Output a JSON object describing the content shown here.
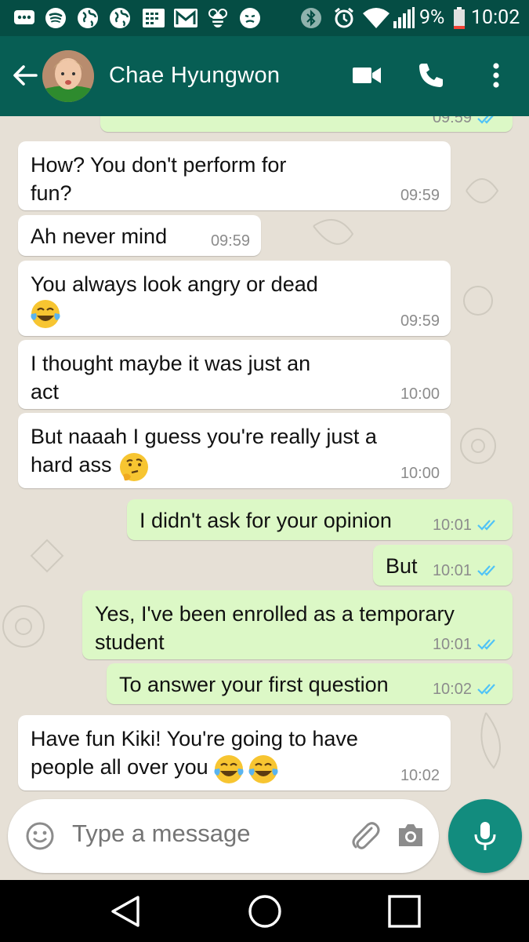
{
  "status_bar": {
    "battery": "9%",
    "time": "10:02"
  },
  "header": {
    "contact_name": "Chae Hyungwon"
  },
  "messages": [
    {
      "dir": "in",
      "lines": [
        "How? You don't perform for",
        "fun?"
      ],
      "time": "09:59"
    },
    {
      "dir": "in",
      "lines": [
        "Ah never mind"
      ],
      "time": "09:59"
    },
    {
      "dir": "in",
      "lines": [
        "You always look angry or dead",
        ""
      ],
      "emoji": "laughing-crying",
      "time": "09:59"
    },
    {
      "dir": "in",
      "lines": [
        "I thought maybe it was just an",
        "act"
      ],
      "time": "10:00"
    },
    {
      "dir": "in",
      "lines": [
        "But naaah I guess you're really just a",
        "hard ass"
      ],
      "emoji": "thinking",
      "time": "10:00"
    },
    {
      "dir": "out",
      "lines": [
        "I didn't ask for your opinion"
      ],
      "time": "10:01",
      "read": true
    },
    {
      "dir": "out",
      "lines": [
        "But"
      ],
      "time": "10:01",
      "read": true
    },
    {
      "dir": "out",
      "lines": [
        "Yes, I've been enrolled as a temporary",
        "student"
      ],
      "time": "10:01",
      "read": true
    },
    {
      "dir": "out",
      "lines": [
        "To answer your first question"
      ],
      "time": "10:02",
      "read": true
    },
    {
      "dir": "in",
      "lines": [
        "Have fun Kiki! You're going to have",
        "people all over you"
      ],
      "emoji": "laughing-crying x2",
      "time": "10:02"
    }
  ],
  "top_partial_message": {
    "time": "09:59"
  },
  "input": {
    "placeholder": "Type a message"
  },
  "colors": {
    "status_bar": "#054d44",
    "header": "#075e54",
    "outgoing_bubble": "#dcf8c6",
    "incoming_bubble": "#ffffff",
    "read_ticks": "#4fc3f7",
    "mic_button": "#128c7e"
  },
  "icons": [
    "back-arrow-icon",
    "video-call-icon",
    "phone-icon",
    "more-options-icon",
    "emoji-icon",
    "attach-icon",
    "camera-icon",
    "mic-icon",
    "nav-back-icon",
    "nav-home-icon",
    "nav-recents-icon"
  ]
}
